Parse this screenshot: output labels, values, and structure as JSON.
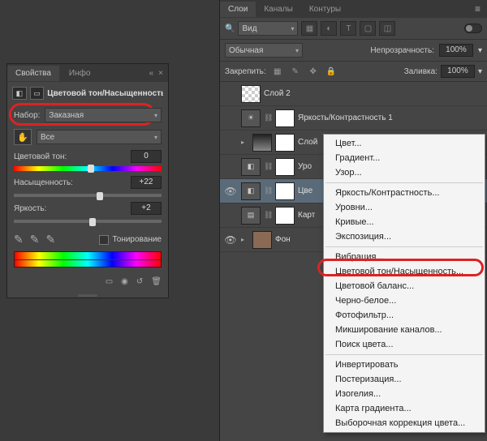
{
  "props": {
    "tab_properties": "Свойства",
    "tab_info": "Инфо",
    "adj_title": "Цветовой тон/Насыщенность",
    "preset_label": "Набор:",
    "preset_value": "Заказная",
    "range_value": "Все",
    "hue_label": "Цветовой тон:",
    "hue_value": "0",
    "sat_label": "Насыщенность:",
    "sat_value": "+22",
    "light_label": "Яркость:",
    "light_value": "+2",
    "colorize_label": "Тонирование"
  },
  "layers_panel": {
    "tab_layers": "Слои",
    "tab_channels": "Каналы",
    "tab_paths": "Контуры",
    "filter_kind": "Вид",
    "blend_mode": "Обычная",
    "opacity_label": "Непрозрачность:",
    "opacity_value": "100%",
    "lock_label": "Закрепить:",
    "fill_label": "Заливка:",
    "fill_value": "100%",
    "layers": [
      {
        "name": "Слой 2"
      },
      {
        "name": "Яркость/Контрастность 1"
      },
      {
        "name": "Слой"
      },
      {
        "name": "Уро"
      },
      {
        "name": "Цве"
      },
      {
        "name": "Карт"
      },
      {
        "name": "Фон"
      }
    ]
  },
  "menu": {
    "m1": "Цвет...",
    "m2": "Градиент...",
    "m3": "Узор...",
    "m4": "Яркость/Контрастность...",
    "m5": "Уровни...",
    "m6": "Кривые...",
    "m7": "Экспозиция...",
    "m8": "Вибрация...",
    "m9": "Цветовой тон/Насыщенность...",
    "m10": "Цветовой баланс...",
    "m11": "Черно-белое...",
    "m12": "Фотофильтр...",
    "m13": "Микширование каналов...",
    "m14": "Поиск цвета...",
    "m15": "Инвертировать",
    "m16": "Постеризация...",
    "m17": "Изогелия...",
    "m18": "Карта градиента...",
    "m19": "Выборочная коррекция цвета..."
  }
}
